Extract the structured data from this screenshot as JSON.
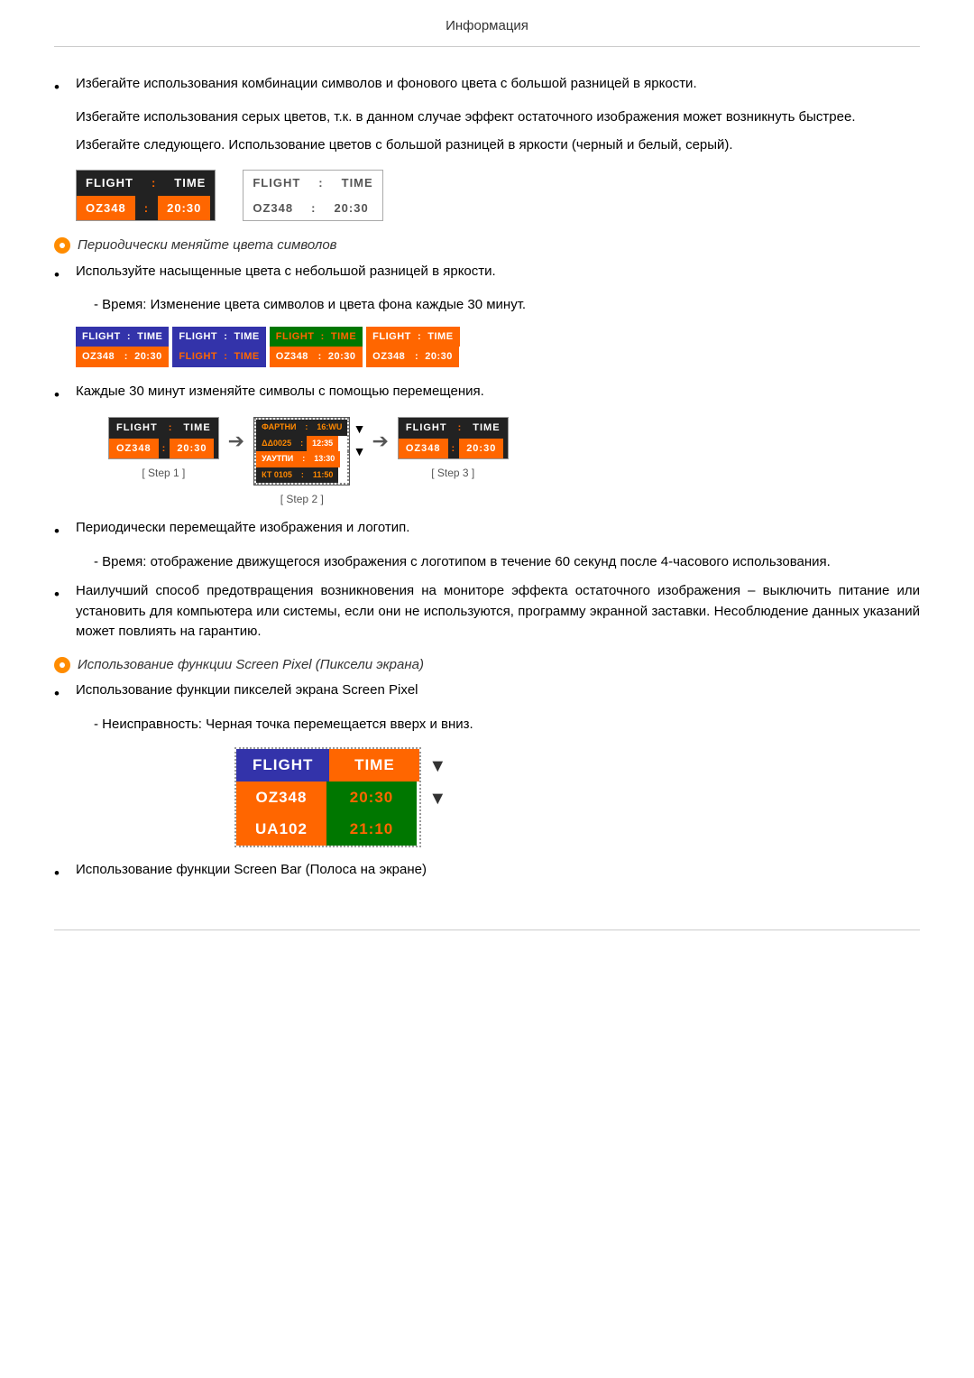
{
  "header": {
    "title": "Информация"
  },
  "sections": {
    "bullet1": {
      "text": "Избегайте использования комбинации символов и фонового цвета с большой разницей в яркости."
    },
    "indent1": {
      "text": "Избегайте использования серых цветов, т.к. в данном случае эффект остаточного изображения может возникнуть быстрее."
    },
    "indent2": {
      "text": "Избегайте следующего. Использование цветов с большой разницей в яркости (черный и белый, серый)."
    },
    "dark_box": {
      "header1": "FLIGHT",
      "colon1": ":",
      "header2": "TIME",
      "data1": "OZ348",
      "colon2": ":",
      "data2": "20:30"
    },
    "light_box": {
      "header1": "FLIGHT",
      "colon1": ":",
      "header2": "TIME",
      "data1": "OZ348",
      "colon2": ":",
      "data2": "20:30"
    },
    "orange_label": "Периодически меняйте цвета символов",
    "bullet2": {
      "text": "Используйте насыщенные цвета с небольшой разницей в яркости."
    },
    "indent3": {
      "text": "- Время: Изменение цвета символов и цвета фона каждые 30 минут."
    },
    "color_boxes": [
      {
        "bg1": "#4444cc",
        "fg1": "#fff",
        "text1": "FLIGHT  :  TIME",
        "bg2": "#ff6600",
        "fg2": "#fff",
        "text2": "OZ348   :  20:30"
      },
      {
        "bg1": "#4444cc",
        "fg1": "#fff",
        "text1": "FLIGHT  :  TIME",
        "bg2": "#4444cc",
        "fg2": "#ff6600",
        "text2": "FLIGHT  :  TIME"
      },
      {
        "bg1": "#008800",
        "fg1": "#ff6600",
        "text1": "FLIGHT  :  TIME",
        "bg2": "#ff6600",
        "fg2": "#fff",
        "text2": "OZ348   :  20:30"
      },
      {
        "bg1": "#ff6600",
        "fg1": "#fff",
        "text1": "FLIGHT  :  TIME",
        "bg2": "#ff6600",
        "fg2": "#fff",
        "text2": "OZ348   :  20:30"
      }
    ],
    "bullet3": {
      "text": "Каждые 30 минут изменяйте символы с помощью перемещения."
    },
    "steps": [
      {
        "label": "[ Step 1 ]"
      },
      {
        "label": "[ Step 2 ]"
      },
      {
        "label": "[ Step 3 ]"
      }
    ],
    "step1": {
      "header1": "FLIGHT",
      "colon1": ":",
      "header2": "TIME",
      "data1": "OZ348",
      "colon2": ":",
      "data2": "20:30"
    },
    "step2": {
      "row1": "ФАРТНИ : 16:WU",
      "row1b": "ΔΔ0025 : 12:35",
      "row2": "УАУТПИ : 13:30",
      "row2b": "КТ 0105 : 11:50"
    },
    "step3": {
      "header1": "FLIGHT",
      "colon1": ":",
      "header2": "TIME",
      "data1": "OZ348",
      "colon2": ":",
      "data2": "20:30"
    },
    "bullet4": {
      "text": "Периодически перемещайте изображения и логотип."
    },
    "indent4": {
      "text": "- Время: отображение движущегося изображения с логотипом в течение 60 секунд после 4-часового использования."
    },
    "bullet5": {
      "text": "Наилучший способ предотвращения возникновения на мониторе эффекта остаточного изображения – выключить питание или установить для компьютера или системы, если они не используются, программу экранной заставки. Несоблюдение данных указаний может повлиять на гарантию."
    },
    "orange_label2": "Использование функции Screen Pixel (Пиксели экрана)",
    "bullet6": {
      "text": "Использование функции пикселей экрана Screen Pixel"
    },
    "indent5": {
      "text": "- Неисправность: Черная точка перемещается вверх и вниз."
    },
    "pixel_box": {
      "cell1_text": "FLIGHT",
      "cell2_text": "TIME",
      "cell3_text": "OZ348",
      "cell4_text": "20:30",
      "cell5_text": "UA102",
      "cell6_text": "21:10"
    },
    "bullet7": {
      "text": "Использование функции Screen Bar (Полоса на экране)"
    }
  }
}
